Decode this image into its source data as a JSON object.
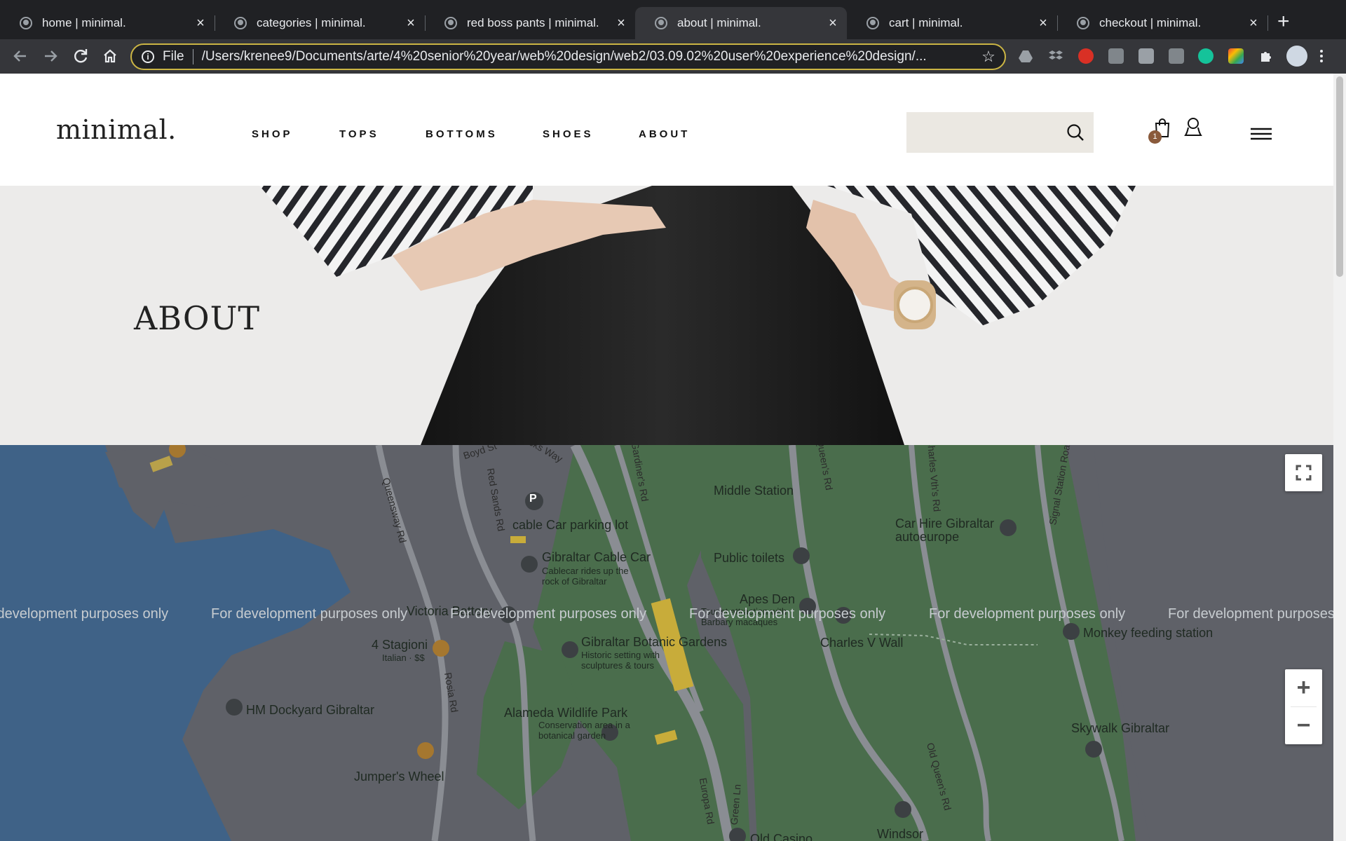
{
  "browser": {
    "tabs": [
      {
        "title": "home | minimal.",
        "active": false
      },
      {
        "title": "categories | minimal.",
        "active": false
      },
      {
        "title": "red boss pants | minimal.",
        "active": false
      },
      {
        "title": "about | minimal.",
        "active": true
      },
      {
        "title": "cart | minimal.",
        "active": false
      },
      {
        "title": "checkout | minimal.",
        "active": false
      }
    ],
    "new_tab": "+",
    "close_glyph": "×",
    "scheme": "File",
    "url": "/Users/krenee9/Documents/arte/4%20senior%20year/web%20design/web2/03.09.02%20user%20experience%20design/..."
  },
  "site": {
    "logo": "minimal.",
    "nav": [
      "SHOP",
      "TOPS",
      "BOTTOMS",
      "SHOES",
      "ABOUT"
    ],
    "search": {
      "placeholder": "",
      "value": ""
    },
    "cart_count": "1"
  },
  "hero": {
    "title": "ABOUT"
  },
  "map": {
    "watermark": "For development purposes only",
    "labels": {
      "boyd_st": "Boyd St",
      "ellicks_way": "Ellicks Way",
      "middle_station": "Middle Station",
      "cable_car_parking": "cable Car parking lot",
      "gibraltar_cable_car": "Gibraltar Cable Car",
      "cable_car_desc": "Cablecar rides up the rock of Gibraltar",
      "public_toilets": "Public toilets",
      "car_hire": "Car Hire Gibraltar autoeurope",
      "apes_den": "Apes Den",
      "apes_den_desc": "Tourist attraction with Barbary macaques",
      "victoria_battery": "Victoria Battery",
      "charles_v_wall": "Charles V Wall",
      "monkey_feeding": "Monkey feeding station",
      "stagioni": "4 Stagioni",
      "stagioni_desc": "Italian · $$",
      "botanic_gardens": "Gibraltar Botanic Gardens",
      "botanic_desc": "Historic setting with sculptures & tours",
      "hm_dockyard": "HM Dockyard Gibraltar",
      "alameda": "Alameda Wildlife Park",
      "alameda_desc": "Conservation area in a botanical garden",
      "skywalk": "Skywalk Gibraltar",
      "jumpers_wheel": "Jumper's Wheel",
      "windsor": "Windsor",
      "old_casino": "Old Casino",
      "queensway_rd": "Queensway Rd",
      "red_sands_rd": "Red Sands Rd",
      "rosia_rd": "Rosia Rd",
      "europa_rd": "Europa Rd",
      "green_ln": "Green Ln",
      "old_queens_rd": "Old Queen's Rd",
      "charles_vths_rd": "Charles Vth's Rd",
      "signal_station_rd": "Signal Station Road",
      "gardiners_rd": "Gardiner's Rd",
      "queens_rd": "Queen's Rd",
      "parking_letter": "P"
    },
    "zoom_in": "+",
    "zoom_out": "−"
  },
  "colors": {
    "chrome_dark": "#202124",
    "chrome_mid": "#35363a",
    "omnibox_ring": "#cbb544",
    "search_bg": "#ebe8e2",
    "cart_badge": "#8a5a3b",
    "water": "#3f6287",
    "land": "#5f6168",
    "park": "#4a6d4c"
  }
}
